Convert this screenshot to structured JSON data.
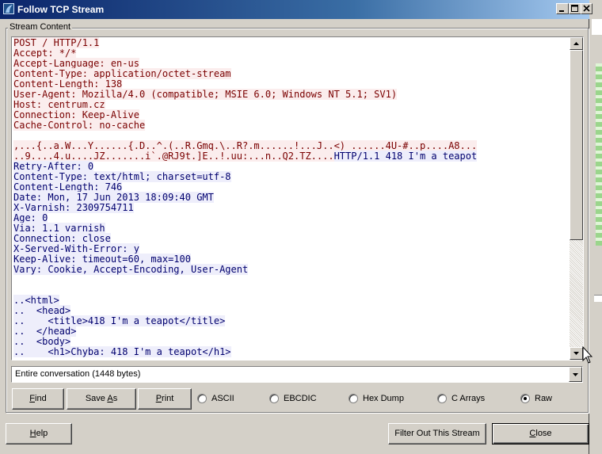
{
  "window": {
    "title": "Follow TCP Stream",
    "minimize_glyph": "minimize-icon",
    "maximize_glyph": "maximize-icon",
    "close_glyph": "close-icon"
  },
  "stream_group": {
    "legend": "Stream Content"
  },
  "stream": {
    "colors": {
      "client_text": "#7a0000",
      "client_bg": "#fbeded",
      "server_text": "#00006e",
      "server_bg": "#eeeefb"
    },
    "lines": [
      {
        "dir": "c",
        "text": "POST / HTTP/1.1"
      },
      {
        "dir": "c",
        "text": "Accept: */*"
      },
      {
        "dir": "c",
        "text": "Accept-Language: en-us"
      },
      {
        "dir": "c",
        "text": "Content-Type: application/octet-stream"
      },
      {
        "dir": "c",
        "text": "Content-Length: 138"
      },
      {
        "dir": "c",
        "text": "User-Agent: Mozilla/4.0 (compatible; MSIE 6.0; Windows NT 5.1; SV1)"
      },
      {
        "dir": "c",
        "text": "Host: centrum.cz"
      },
      {
        "dir": "c",
        "text": "Connection: Keep-Alive"
      },
      {
        "dir": "c",
        "text": "Cache-Control: no-cache"
      },
      {
        "dir": "blank",
        "text": ""
      },
      {
        "dir": "c",
        "text": ",...{..a.W...Y......{.D..^.(..R.Gmq.\\..R?.m......!...J..<) ......4U-#..p....A8..."
      },
      {
        "dir": "mix",
        "text": "..9....4.u....JZ.......i`.@RJ9t.]E..!.uu:...n..Q2.TZ....",
        "text2": "HTTP/1.1 418 I'm a teapot"
      },
      {
        "dir": "s",
        "text": "Retry-After: 0"
      },
      {
        "dir": "s",
        "text": "Content-Type: text/html; charset=utf-8"
      },
      {
        "dir": "s",
        "text": "Content-Length: 746"
      },
      {
        "dir": "s",
        "text": "Date: Mon, 17 Jun 2013 18:09:40 GMT"
      },
      {
        "dir": "s",
        "text": "X-Varnish: 2309754711"
      },
      {
        "dir": "s",
        "text": "Age: 0"
      },
      {
        "dir": "s",
        "text": "Via: 1.1 varnish"
      },
      {
        "dir": "s",
        "text": "Connection: close"
      },
      {
        "dir": "s",
        "text": "X-Served-With-Error: y"
      },
      {
        "dir": "s",
        "text": "Keep-Alive: timeout=60, max=100"
      },
      {
        "dir": "s",
        "text": "Vary: Cookie, Accept-Encoding, User-Agent"
      },
      {
        "dir": "blank",
        "text": ""
      },
      {
        "dir": "blank",
        "text": ""
      },
      {
        "dir": "s",
        "text": "..<html>"
      },
      {
        "dir": "s",
        "text": "..  <head>"
      },
      {
        "dir": "s",
        "text": "..    <title>418 I'm a teapot</title>"
      },
      {
        "dir": "s",
        "text": "..  </head>"
      },
      {
        "dir": "s",
        "text": "..  <body>"
      },
      {
        "dir": "s",
        "text": "..    <h1>Chyba: 418 I'm a teapot</h1>"
      }
    ]
  },
  "conversation_select": {
    "value": "Entire conversation (1448 bytes)"
  },
  "actions": {
    "find": {
      "label": "Find",
      "mnemonic": "F",
      "rest": "ind"
    },
    "save_as": {
      "label": "Save As",
      "pre": "Save ",
      "mnemonic": "A",
      "rest": "s"
    },
    "print": {
      "label": "Print",
      "mnemonic": "P",
      "rest": "rint"
    }
  },
  "formats": [
    {
      "label": "ASCII",
      "selected": false
    },
    {
      "label": "EBCDIC",
      "selected": false
    },
    {
      "label": "Hex Dump",
      "selected": false
    },
    {
      "label": "C Arrays",
      "selected": false
    },
    {
      "label": "Raw",
      "selected": true
    }
  ],
  "footer": {
    "help": {
      "mnemonic": "H",
      "rest": "elp"
    },
    "filter_out": "Filter Out This Stream",
    "close": {
      "mnemonic": "C",
      "rest": "lose"
    }
  }
}
